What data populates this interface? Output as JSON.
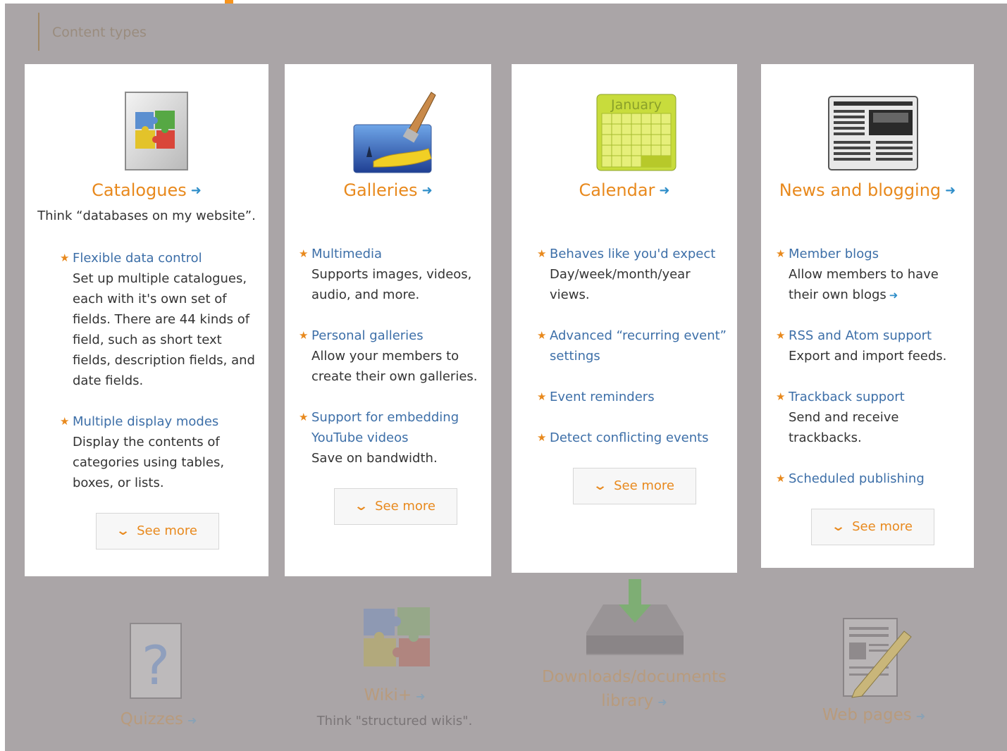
{
  "section": {
    "title": "Content types"
  },
  "cards": [
    {
      "title": "Catalogues",
      "tagline": "Think “databases on my website”.",
      "icon": "puzzle-box-icon",
      "features": [
        {
          "title": "Flexible data control",
          "desc": "Set up multiple catalogues, each with it's own set of fields. There are 44 kinds of field, such as short text fields, description fields, and date fields."
        },
        {
          "title": "Multiple display modes",
          "desc": "Display the contents of categories using tables, boxes, or lists."
        }
      ],
      "button": "See more"
    },
    {
      "title": "Galleries",
      "icon": "paintbrush-picture-icon",
      "features": [
        {
          "title": "Multimedia",
          "desc": "Supports images, videos, audio, and more."
        },
        {
          "title": "Personal galleries",
          "desc": "Allow your members to create their own galleries."
        },
        {
          "title": "Support for embedding YouTube videos",
          "desc": "Save on bandwidth."
        }
      ],
      "button": "See more"
    },
    {
      "title": "Calendar",
      "icon": "calendar-icon",
      "calendar_month": "January",
      "features": [
        {
          "title": "Behaves like you'd expect",
          "desc": "Day/week/month/year views."
        },
        {
          "title": "Advanced “recurring event” settings",
          "desc": ""
        },
        {
          "title": "Event reminders",
          "desc": ""
        },
        {
          "title": "Detect conflicting events",
          "desc": ""
        }
      ],
      "button": "See more"
    },
    {
      "title": "News and blogging",
      "icon": "newspaper-icon",
      "features": [
        {
          "title": "Member blogs",
          "desc": "Allow members to have their own blogs"
        },
        {
          "title": "RSS and Atom support",
          "desc": "Export and import feeds."
        },
        {
          "title": "Trackback support",
          "desc": "Send and receive trackbacks."
        },
        {
          "title": "Scheduled publishing",
          "desc": ""
        }
      ],
      "button": "See more"
    }
  ],
  "faded_items": [
    {
      "title": "Quizzes",
      "icon": "question-page-icon"
    },
    {
      "title": "Wiki+",
      "subtitle": "Think \"structured wikis\".",
      "icon": "puzzle-icon"
    },
    {
      "title_line1": "Downloads/documents",
      "title_line2": "library",
      "icon": "download-tray-icon"
    },
    {
      "title": "Web pages",
      "icon": "page-pencil-icon"
    }
  ],
  "colors": {
    "accent": "#e8891d",
    "link": "#3d6fa8",
    "arrow": "#2f8ec9",
    "overlay": "#aaa5a7"
  }
}
